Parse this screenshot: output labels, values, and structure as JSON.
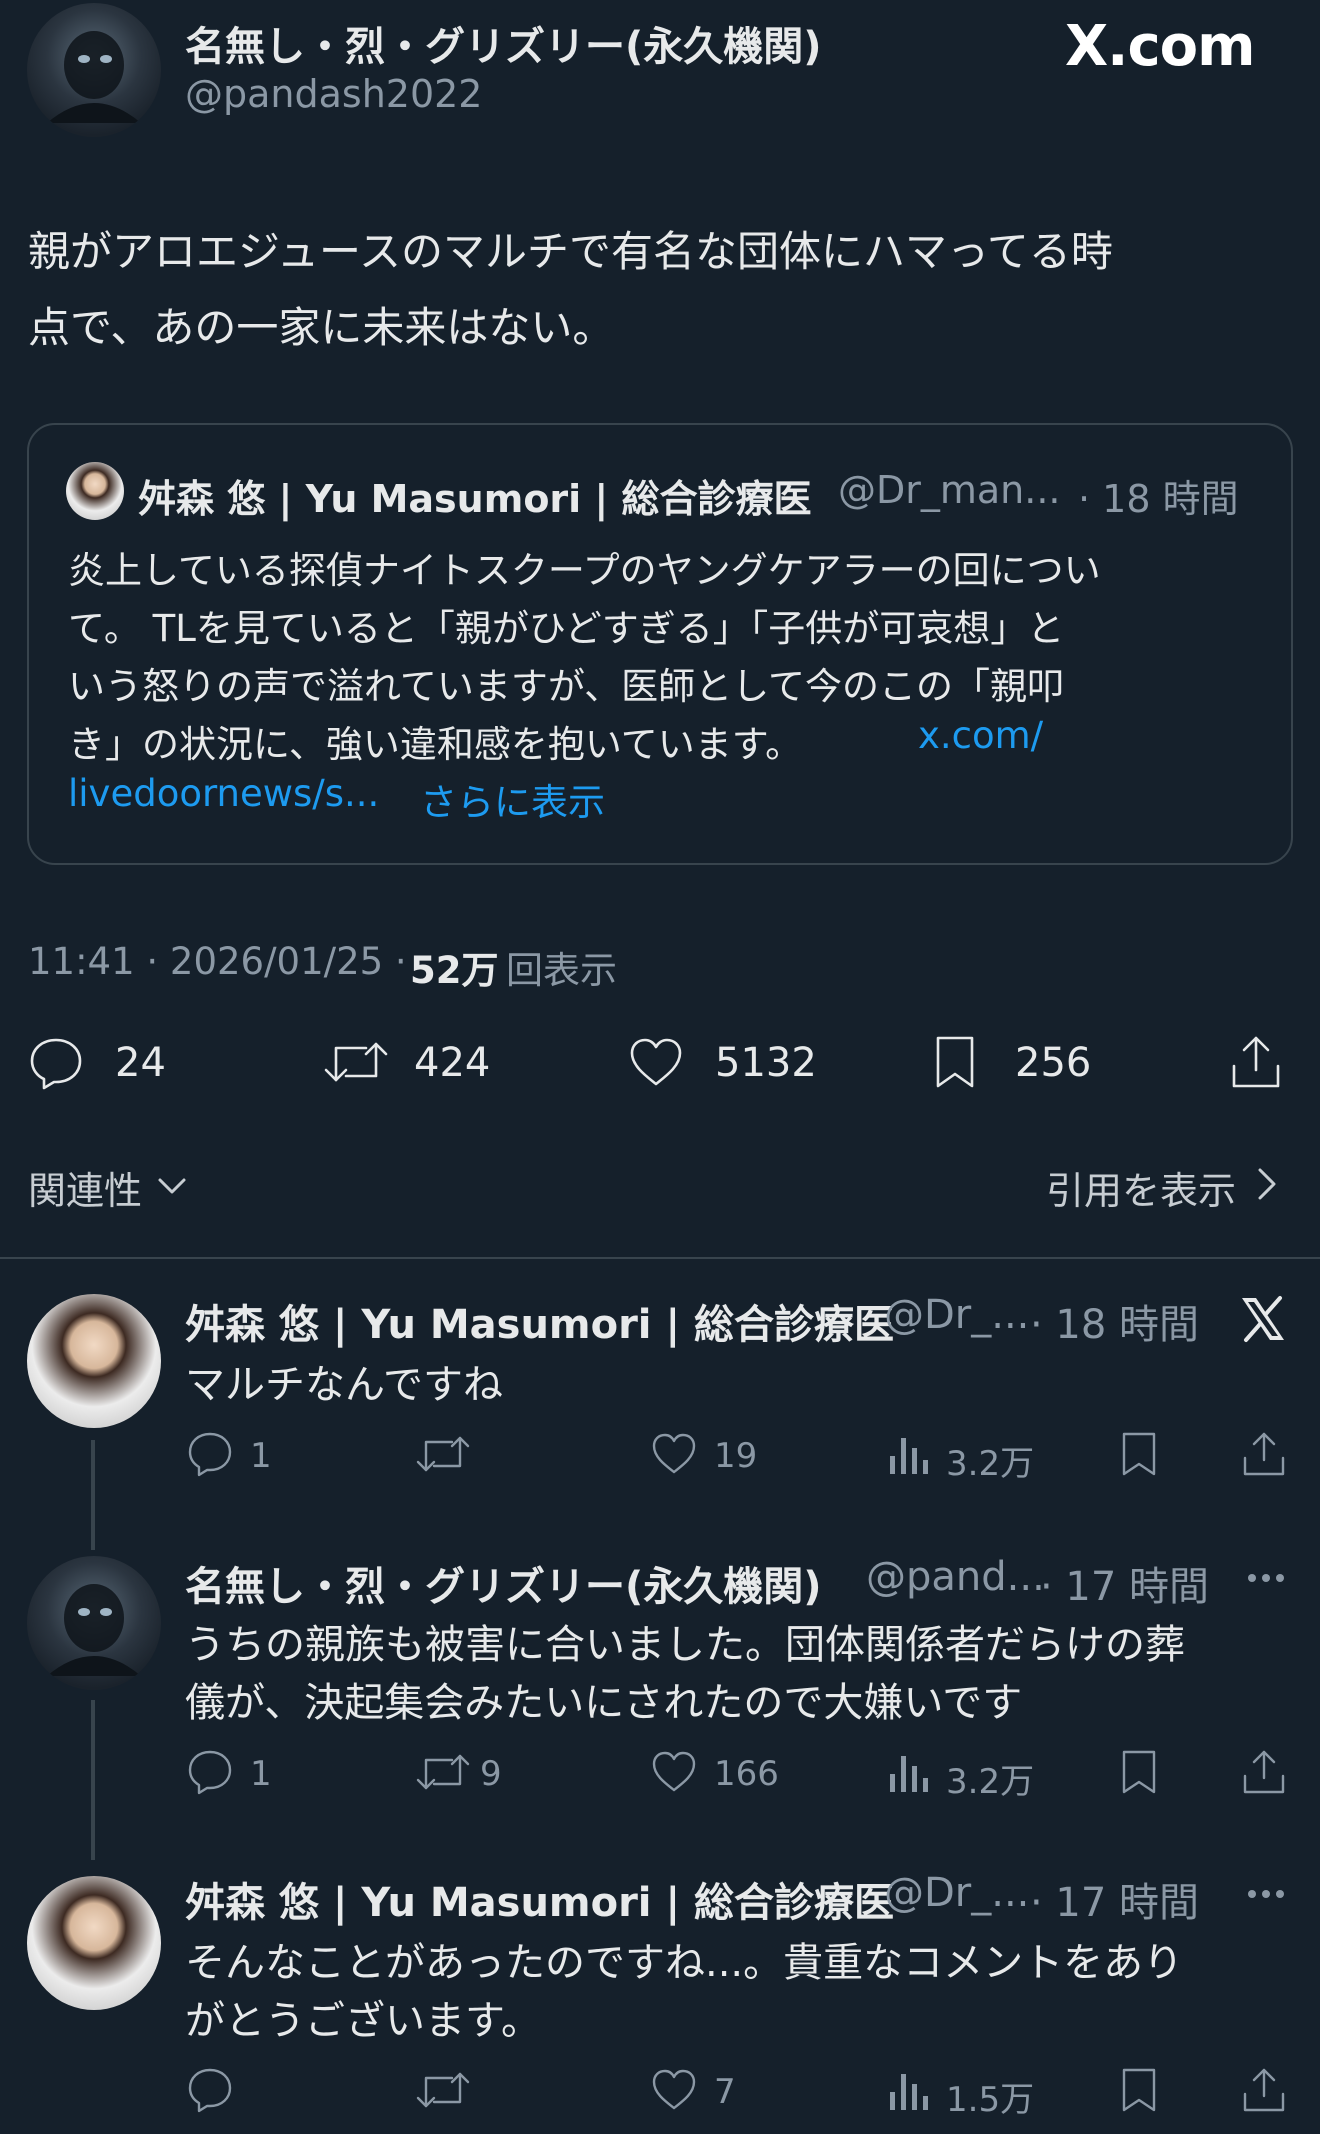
{
  "watermark": "X.com",
  "tweet": {
    "author_name": "名無し・烈・グリズリー(永久機関)",
    "author_handle": "@pandash2022",
    "text_line1": "親がアロエジュースのマルチで有名な団体にハマってる時",
    "text_line2": "点で、あの一家に未来はない。",
    "quote": {
      "author_name": "舛森 悠 | Yu Masumori | 総合診療医",
      "author_handle": "@Dr_man...",
      "time": "· 18 時間",
      "line1": "炎上している探偵ナイトスクープのヤングケアラーの回につい",
      "line2": "て。 TLを見ていると「親がひどすぎる」「子供が可哀想」と",
      "line3": "いう怒りの声で溢れていますが、医師として今のこの「親叩",
      "line4": "き」の状況に、強い違和感を抱いています。",
      "link1": "x.com/",
      "link2": "livedoornews/s...",
      "show_more": "さらに表示"
    },
    "meta_time": "11:41 · 2026/01/25 ·",
    "views_count": "52万",
    "views_label": "回表示",
    "actions": {
      "replies": "24",
      "reposts": "424",
      "likes": "5132",
      "bookmarks": "256"
    },
    "sort_label": "関連性",
    "quotes_link": "引用を表示"
  },
  "replies": [
    {
      "author_name": "舛森 悠 | Yu Masumori | 総合診療医",
      "handle": "@Dr_...",
      "time": "· 18 時間",
      "line1": "マルチなんですね",
      "line2": "",
      "replies": "1",
      "reposts": "",
      "likes": "19",
      "views": "3.2万"
    },
    {
      "author_name": "名無し・烈・グリズリー(永久機関)",
      "handle": "@pand...",
      "time": "· 17 時間",
      "line1": "うちの親族も被害に合いました。団体関係者だらけの葬",
      "line2": "儀が、決起集会みたいにされたので大嫌いです",
      "replies": "1",
      "reposts": "9",
      "likes": "166",
      "views": "3.2万"
    },
    {
      "author_name": "舛森 悠 | Yu Masumori | 総合診療医",
      "handle": "@Dr_...",
      "time": "· 17 時間",
      "line1": "そんなことがあったのですね...。貴重なコメントをあり",
      "line2": "がとうございます。",
      "replies": "",
      "reposts": "",
      "likes": "7",
      "views": "1.5万"
    }
  ]
}
